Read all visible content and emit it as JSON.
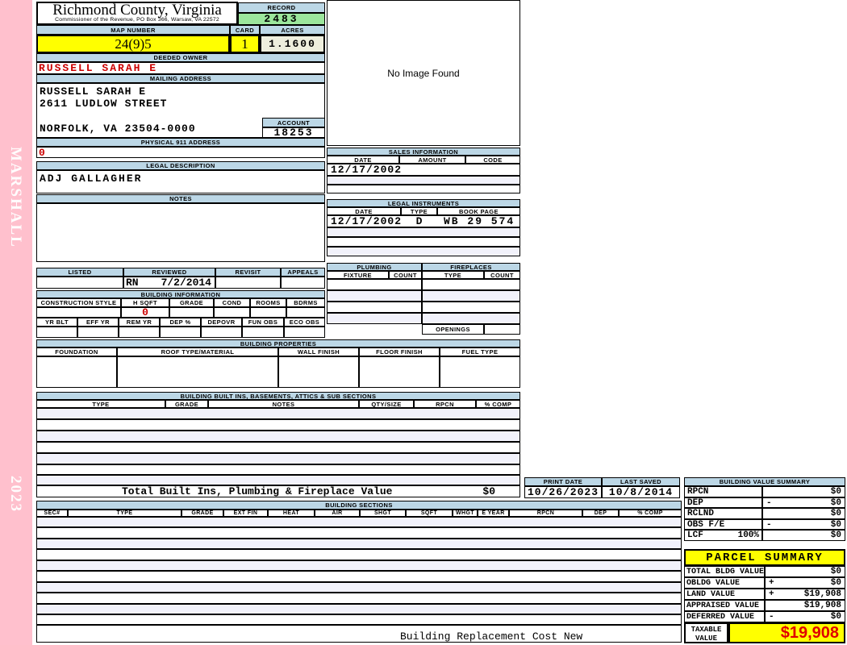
{
  "sidebar": {
    "vendor": "MARSHALL",
    "year": "2023"
  },
  "header": {
    "county": "Richmond County, Virginia",
    "commissioner_line": "Commissioner of the Revenue, PO Box 366, Warsaw, VA 22572",
    "record_label": "RECORD",
    "record_value": "2483",
    "map_number_label": "MAP NUMBER",
    "map_number": "24(9)5",
    "card_label": "CARD",
    "card": "1",
    "acres_label": "ACRES",
    "acres": "1.1600"
  },
  "owner": {
    "deeded_owner_label": "DEEDED OWNER",
    "deeded_owner": "RUSSELL SARAH E",
    "mailing_address_label": "MAILING ADDRESS",
    "mailing_line1": "RUSSELL SARAH E",
    "mailing_line2": "2611 LUDLOW STREET",
    "mailing_line3": "NORFOLK, VA 23504-0000",
    "account_label": "ACCOUNT",
    "account": "18253",
    "physical_911_label": "PHYSICAL 911 ADDRESS",
    "physical_911": "0",
    "legal_description_label": "LEGAL DESCRIPTION",
    "legal_description": "ADJ GALLAGHER",
    "notes_label": "NOTES"
  },
  "no_image_text": "No Image Found",
  "review": {
    "listed_label": "LISTED",
    "reviewed_label": "REVIEWED",
    "revisit_label": "REVISIT",
    "appeals_label": "APPEALS",
    "reviewed_by": "RN",
    "reviewed_date": "7/2/2014"
  },
  "building_information": {
    "title": "BUILDING INFORMATION",
    "row1_headers": [
      "CONSTRUCTION STYLE",
      "H SQFT",
      "GRADE",
      "COND",
      "ROOMS",
      "BDRMS"
    ],
    "h_sqft": "0",
    "row2_headers": [
      "YR BLT",
      "EFF YR",
      "REM YR",
      "DEP %",
      "DEPOVR",
      "FUN OBS",
      "ECO OBS"
    ]
  },
  "sales_information": {
    "title": "SALES INFORMATION",
    "headers": [
      "DATE",
      "AMOUNT",
      "CODE"
    ],
    "rows": [
      {
        "date": "12/17/2002",
        "amount": "",
        "code": ""
      }
    ]
  },
  "legal_instruments": {
    "title": "LEGAL INSTRUMENTS",
    "headers": [
      "DATE",
      "TYPE",
      "BOOK PAGE"
    ],
    "rows": [
      {
        "date": "12/17/2002",
        "type": "D",
        "book_page": "WB 29 574"
      }
    ]
  },
  "plumbing": {
    "title": "PLUMBING",
    "headers": [
      "FIXTURE",
      "COUNT"
    ]
  },
  "fireplaces": {
    "title": "FIREPLACES",
    "headers": [
      "TYPE",
      "COUNT"
    ],
    "openings_label": "OPENINGS"
  },
  "building_properties": {
    "title": "BUILDING PROPERTIES",
    "headers": [
      "FOUNDATION",
      "ROOF TYPE/MATERIAL",
      "WALL FINISH",
      "FLOOR FINISH",
      "FUEL TYPE"
    ]
  },
  "built_ins": {
    "title": "BUILDING BUILT INS, BASEMENTS, ATTICS & SUB SECTIONS",
    "headers": [
      "TYPE",
      "GRADE",
      "NOTES",
      "QTY/SIZE",
      "RPCN",
      "% COMP"
    ],
    "total_label": "Total Built Ins, Plumbing & Fireplace Value",
    "total_value": "$0"
  },
  "print_info": {
    "print_date_label": "PRINT DATE",
    "print_date": "10/26/2023",
    "last_saved_label": "LAST SAVED",
    "last_saved": "10/8/2014"
  },
  "building_value_summary": {
    "title": "BUILDING VALUE SUMMARY",
    "rows": [
      {
        "label": "RPCN",
        "sub": "",
        "op": "",
        "value": "$0"
      },
      {
        "label": "DEP",
        "sub": "",
        "op": "-",
        "value": "$0"
      },
      {
        "label": "RCLND",
        "sub": "",
        "op": "",
        "value": "$0"
      },
      {
        "label": "OBS F/E",
        "sub": "",
        "op": "-",
        "value": "$0"
      },
      {
        "label": "LCF",
        "sub": "100%",
        "op": "",
        "value": "$0"
      }
    ]
  },
  "building_sections": {
    "title": "BUILDING SECTIONS",
    "headers": [
      "SEC#",
      "TYPE",
      "GRADE",
      "EXT FIN",
      "HEAT",
      "AIR",
      "SHGT",
      "SQFT",
      "WHGT",
      "E YEAR",
      "RPCN",
      "DEP",
      "% COMP"
    ],
    "footer_note": "Building Replacement Cost New"
  },
  "parcel_summary": {
    "title": "PARCEL SUMMARY",
    "rows": [
      {
        "label": "TOTAL BLDG VALUE",
        "op": "",
        "value": "$0"
      },
      {
        "label": "OBLDG VALUE",
        "op": "+",
        "value": "$0"
      },
      {
        "label": "LAND VALUE",
        "op": "+",
        "value": "$19,908"
      },
      {
        "label": "APPRAISED VALUE",
        "op": "",
        "value": "$19,908"
      },
      {
        "label": "DEFERRED VALUE",
        "op": "-",
        "value": "$0"
      }
    ],
    "taxable_label_1": "TAXABLE",
    "taxable_label_2": "VALUE",
    "taxable_value": "$19,908"
  },
  "colors": {
    "accent_blue": "#bcd7e6",
    "highlight_yellow": "#ffff00",
    "record_green": "#9ce69c",
    "alert_red": "#cc0000"
  }
}
